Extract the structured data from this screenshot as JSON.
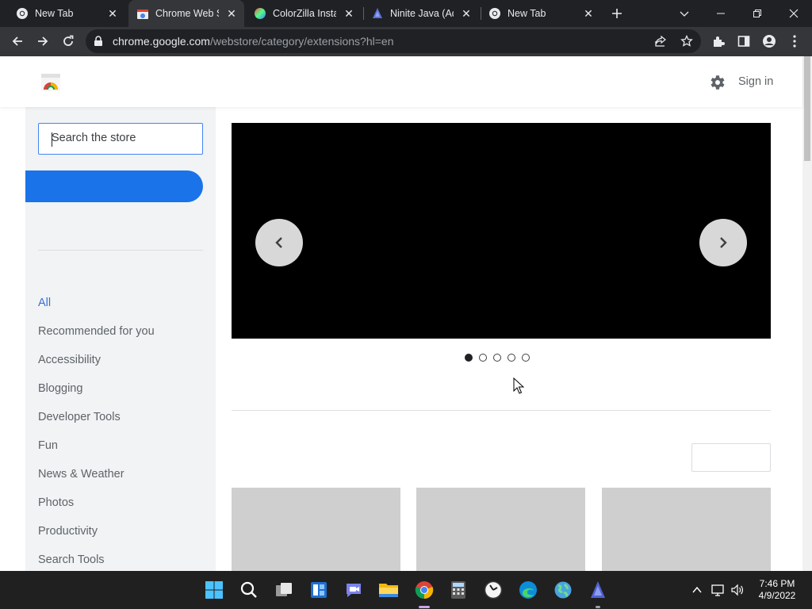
{
  "browser": {
    "tabs": [
      {
        "title": "New Tab",
        "favicon": "chrome-icon",
        "active": false
      },
      {
        "title": "Chrome Web Store",
        "favicon": "webstore-icon",
        "active": true
      },
      {
        "title": "ColorZilla Installed",
        "favicon": "colorzilla-icon",
        "active": false
      },
      {
        "title": "Ninite Java (Adoptium)",
        "favicon": "ninite-icon",
        "active": false
      },
      {
        "title": "New Tab",
        "favicon": "chrome-icon",
        "active": false
      }
    ],
    "address": {
      "host": "chrome.google.com",
      "path": "/webstore/category/extensions?hl=en"
    }
  },
  "store": {
    "header": {
      "sign_in_label": "Sign in"
    },
    "search": {
      "placeholder": "Search the store"
    },
    "categories": [
      {
        "label": "All",
        "selected": true
      },
      {
        "label": "Recommended for you",
        "selected": false
      },
      {
        "label": "Accessibility",
        "selected": false
      },
      {
        "label": "Blogging",
        "selected": false
      },
      {
        "label": "Developer Tools",
        "selected": false
      },
      {
        "label": "Fun",
        "selected": false
      },
      {
        "label": "News & Weather",
        "selected": false
      },
      {
        "label": "Photos",
        "selected": false
      },
      {
        "label": "Productivity",
        "selected": false
      },
      {
        "label": "Search Tools",
        "selected": false
      }
    ],
    "carousel": {
      "slide_count": 5,
      "active_index": 0
    }
  },
  "taskbar": {
    "apps": [
      "start-icon",
      "search-icon",
      "task-view-icon",
      "widgets-icon",
      "teams-chat-icon",
      "file-explorer-icon",
      "chrome-icon",
      "calculator-icon",
      "clock-app-icon",
      "edge-icon",
      "globe-app-icon",
      "ninite-icon"
    ],
    "clock": {
      "time": "7:46 PM",
      "date": "4/9/2022"
    }
  },
  "colors": {
    "accent": "#1a73e8",
    "selected_category": "#3c6fd8",
    "chrome_dark": "#202124",
    "toolbar_dark": "#35363a"
  }
}
